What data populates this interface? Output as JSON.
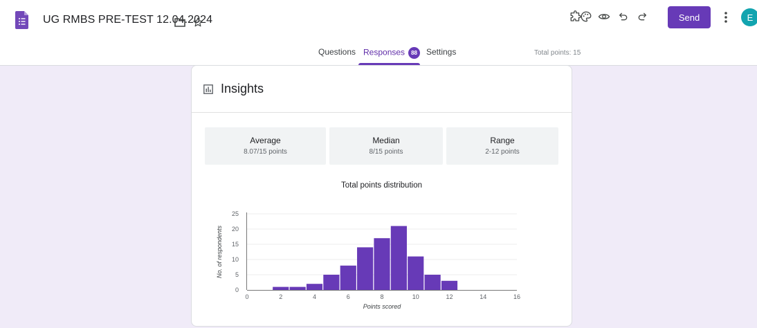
{
  "header": {
    "title": "UG RMBS PRE-TEST 12.04.2024",
    "send_label": "Send",
    "avatar_initial": "E",
    "accent_color": "#673ab7"
  },
  "tabs": {
    "items": [
      {
        "label": "Questions"
      },
      {
        "label": "Responses",
        "badge": "88"
      },
      {
        "label": "Settings"
      }
    ],
    "total_points": "Total points: 15"
  },
  "insights": {
    "title": "Insights",
    "stats": [
      {
        "label": "Average",
        "value": "8.07/15 points"
      },
      {
        "label": "Median",
        "value": "8/15 points"
      },
      {
        "label": "Range",
        "value": "2-12 points"
      }
    ]
  },
  "chart_data": {
    "type": "bar",
    "title": "Total points distribution",
    "xlabel": "Points scored",
    "ylabel": "No. of respondents",
    "x": [
      2,
      3,
      4,
      5,
      6,
      7,
      8,
      9,
      10,
      11,
      12
    ],
    "values": [
      1,
      1,
      2,
      5,
      8,
      14,
      17,
      21,
      11,
      5,
      3
    ],
    "xlim": [
      0,
      16
    ],
    "ylim": [
      0,
      25
    ],
    "xticks": [
      0,
      2,
      4,
      6,
      8,
      10,
      12,
      14,
      16
    ],
    "yticks": [
      0,
      5,
      10,
      15,
      20,
      25
    ],
    "bar_color": "#673ab7",
    "grid": true
  }
}
